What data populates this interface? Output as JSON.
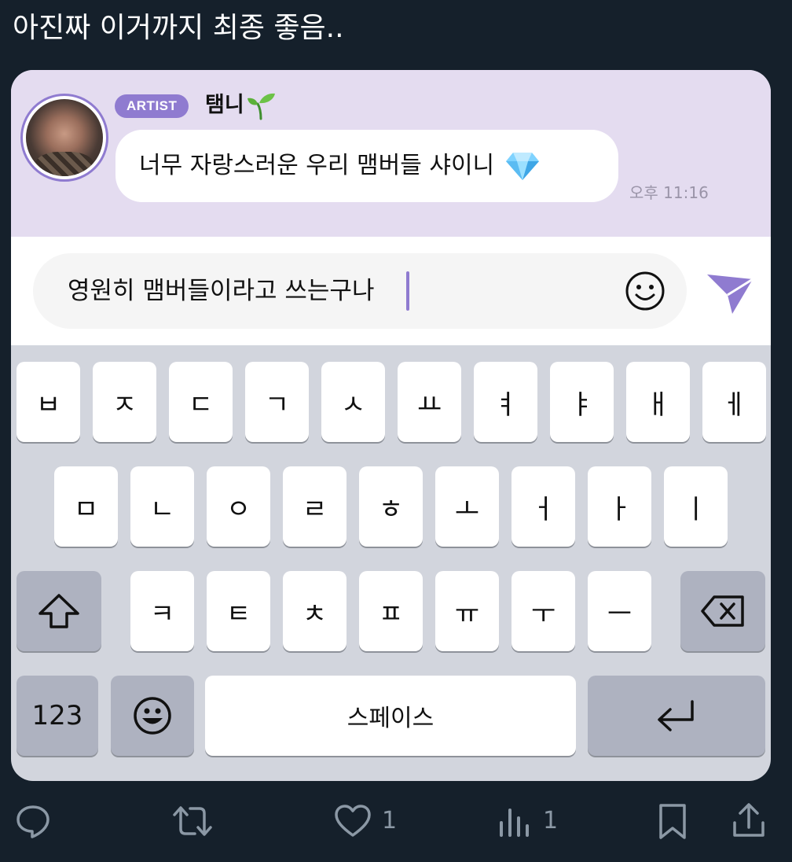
{
  "tweet": {
    "text": "아진짜 이거까지 최종 좋음.."
  },
  "chat": {
    "badge": "ARTIST",
    "sender_name": "탬니",
    "message": "너무 자랑스러운 우리 맴버들 샤이니",
    "time": "오후 11:16"
  },
  "input": {
    "value": "영원히 맴버들이라고 쓰는구나"
  },
  "keyboard": {
    "row1": [
      "ㅂ",
      "ㅈ",
      "ㄷ",
      "ㄱ",
      "ㅅ",
      "ㅛ",
      "ㅕ",
      "ㅑ",
      "ㅐ",
      "ㅔ"
    ],
    "row2": [
      "ㅁ",
      "ㄴ",
      "ㅇ",
      "ㄹ",
      "ㅎ",
      "ㅗ",
      "ㅓ",
      "ㅏ",
      "ㅣ"
    ],
    "row3": [
      "ㅋ",
      "ㅌ",
      "ㅊ",
      "ㅍ",
      "ㅠ",
      "ㅜ",
      "ㅡ"
    ],
    "numbers_label": "123",
    "space_label": "스페이스"
  },
  "actions": {
    "like_count": "1",
    "views_count": "1"
  },
  "colors": {
    "background": "#15202b",
    "accent": "#8f7bd0",
    "chat_bg": "#e4dcf0",
    "keyboard_bg": "#d2d5dd",
    "icon": "#8b98a5"
  },
  "icons": {
    "sprout": "sprout-icon",
    "diamond": "diamond-icon",
    "emoji": "smiley-icon",
    "send": "send-icon",
    "shift": "shift-arrow-icon",
    "backspace": "backspace-icon",
    "return": "return-arrow-icon",
    "reply": "reply-icon",
    "retweet": "retweet-icon",
    "like": "heart-icon",
    "views": "views-icon",
    "bookmark": "bookmark-icon",
    "share": "share-icon"
  }
}
